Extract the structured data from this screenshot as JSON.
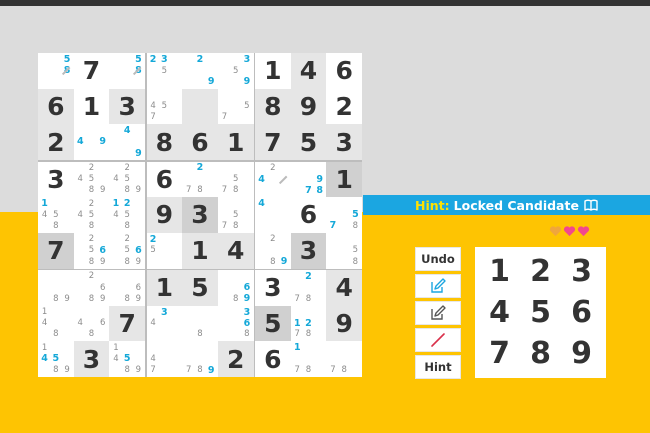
{
  "board": {
    "boxes": [
      {
        "cells": [
          {
            "cands": [
              {
                "n": 5,
                "pos": 2,
                "blue": true
              },
              {
                "n": 8,
                "pos": 5,
                "blue": true
              }
            ],
            "slash": true
          },
          {
            "value": "7"
          },
          {
            "cands": [
              {
                "n": 5,
                "pos": 2,
                "blue": true
              },
              {
                "n": 8,
                "pos": 5,
                "blue": true
              }
            ],
            "slash": true
          },
          {
            "value": "6",
            "hl": true
          },
          {
            "value": "1"
          },
          {
            "value": "3",
            "hl": true
          },
          {
            "value": "2",
            "hl": true
          },
          {
            "cands": [
              {
                "n": 4,
                "pos": 3,
                "blue": true
              },
              {
                "n": 9,
                "pos": 5,
                "blue": true
              }
            ]
          },
          {
            "cands": [
              {
                "n": 4,
                "pos": 1,
                "blue": true
              },
              {
                "n": 9,
                "pos": 8,
                "blue": true
              }
            ]
          }
        ]
      },
      {
        "cells": [
          {
            "cands": [
              {
                "n": 2,
                "pos": 0,
                "blue": true
              },
              {
                "n": 3,
                "pos": 1,
                "blue": true
              },
              {
                "n": 5,
                "pos": 4
              }
            ]
          },
          {
            "cands": [
              {
                "n": 2,
                "pos": 1,
                "blue": true
              },
              {
                "n": 9,
                "pos": 8,
                "blue": true
              }
            ]
          },
          {
            "cands": [
              {
                "n": 3,
                "pos": 2,
                "blue": true
              },
              {
                "n": 5,
                "pos": 4
              },
              {
                "n": 9,
                "pos": 8,
                "blue": true
              }
            ]
          },
          {
            "cands": [
              {
                "n": 4,
                "pos": 3
              },
              {
                "n": 5,
                "pos": 4
              },
              {
                "n": 7,
                "pos": 6
              }
            ]
          },
          {
            "hl": true
          },
          {
            "cands": [
              {
                "n": 5,
                "pos": 5
              },
              {
                "n": 7,
                "pos": 6
              }
            ]
          },
          {
            "value": "8",
            "hl": true
          },
          {
            "value": "6",
            "hl": true
          },
          {
            "value": "1",
            "hl": true
          }
        ]
      },
      {
        "cells": [
          {
            "value": "1"
          },
          {
            "value": "4",
            "hl": true
          },
          {
            "value": "6"
          },
          {
            "value": "8",
            "hl": true
          },
          {
            "value": "9",
            "hl": true
          },
          {
            "value": "2"
          },
          {
            "value": "7",
            "hl": true
          },
          {
            "value": "5",
            "hl": true
          },
          {
            "value": "3",
            "hl": true
          }
        ]
      },
      {
        "cells": [
          {
            "value": "3"
          },
          {
            "cands": [
              {
                "n": 2,
                "pos": 1
              },
              {
                "n": 4,
                "pos": 3
              },
              {
                "n": 5,
                "pos": 4
              },
              {
                "n": 8,
                "pos": 7
              },
              {
                "n": 9,
                "pos": 8
              }
            ]
          },
          {
            "cands": [
              {
                "n": 2,
                "pos": 1
              },
              {
                "n": 4,
                "pos": 3
              },
              {
                "n": 5,
                "pos": 4
              },
              {
                "n": 8,
                "pos": 7
              },
              {
                "n": 9,
                "pos": 8
              }
            ]
          },
          {
            "cands": [
              {
                "n": 1,
                "pos": 0,
                "blue": true
              },
              {
                "n": 4,
                "pos": 3
              },
              {
                "n": 5,
                "pos": 4
              },
              {
                "n": 8,
                "pos": 7
              }
            ]
          },
          {
            "cands": [
              {
                "n": 2,
                "pos": 1
              },
              {
                "n": 4,
                "pos": 3
              },
              {
                "n": 5,
                "pos": 4
              },
              {
                "n": 8,
                "pos": 7
              }
            ]
          },
          {
            "cands": [
              {
                "n": 1,
                "pos": 0,
                "blue": true
              },
              {
                "n": 2,
                "pos": 1,
                "blue": true
              },
              {
                "n": 4,
                "pos": 3
              },
              {
                "n": 5,
                "pos": 4
              },
              {
                "n": 8,
                "pos": 7
              }
            ]
          },
          {
            "value": "7",
            "dark": true
          },
          {
            "cands": [
              {
                "n": 2,
                "pos": 1
              },
              {
                "n": 5,
                "pos": 4
              },
              {
                "n": 6,
                "pos": 5,
                "blue": true
              },
              {
                "n": 8,
                "pos": 7
              },
              {
                "n": 9,
                "pos": 8
              }
            ]
          },
          {
            "cands": [
              {
                "n": 2,
                "pos": 1
              },
              {
                "n": 5,
                "pos": 4
              },
              {
                "n": 6,
                "pos": 5,
                "blue": true
              },
              {
                "n": 8,
                "pos": 7
              },
              {
                "n": 9,
                "pos": 8
              }
            ]
          }
        ]
      },
      {
        "cells": [
          {
            "value": "6"
          },
          {
            "cands": [
              {
                "n": 2,
                "pos": 1,
                "blue": true
              },
              {
                "n": 7,
                "pos": 6
              },
              {
                "n": 8,
                "pos": 7
              }
            ]
          },
          {
            "cands": [
              {
                "n": 5,
                "pos": 4
              },
              {
                "n": 7,
                "pos": 6
              },
              {
                "n": 8,
                "pos": 7
              }
            ]
          },
          {
            "value": "9",
            "hl": true
          },
          {
            "value": "3",
            "dark": true
          },
          {
            "cands": [
              {
                "n": 5,
                "pos": 4
              },
              {
                "n": 7,
                "pos": 6
              },
              {
                "n": 8,
                "pos": 7
              }
            ]
          },
          {
            "cands": [
              {
                "n": 2,
                "pos": 0,
                "blue": true
              },
              {
                "n": 5,
                "pos": 3
              }
            ]
          },
          {
            "value": "1",
            "hl": true
          },
          {
            "value": "4",
            "hl": true
          }
        ]
      },
      {
        "cells": [
          {
            "cands": [
              {
                "n": 2,
                "pos": 1
              },
              {
                "n": 4,
                "pos": 3,
                "blue": true
              }
            ],
            "slash": true
          },
          {
            "cands": [
              {
                "n": 9,
                "pos": 5,
                "blue": true
              },
              {
                "n": 7,
                "pos": 7,
                "blue": true
              },
              {
                "n": 8,
                "pos": 8,
                "blue": true
              }
            ]
          },
          {
            "value": "1",
            "dark": true
          },
          {
            "cands": [
              {
                "n": 4,
                "pos": 0,
                "blue": true
              }
            ]
          },
          {
            "value": "6"
          },
          {
            "cands": [
              {
                "n": 5,
                "pos": 5,
                "blue": true
              },
              {
                "n": 7,
                "pos": 6,
                "blue": true
              },
              {
                "n": 8,
                "pos": 8
              }
            ]
          },
          {
            "cands": [
              {
                "n": 2,
                "pos": 1
              },
              {
                "n": 8,
                "pos": 7
              },
              {
                "n": 9,
                "pos": 8,
                "blue": true
              }
            ]
          },
          {
            "value": "3",
            "dark": true
          },
          {
            "cands": [
              {
                "n": 5,
                "pos": 5
              },
              {
                "n": 8,
                "pos": 8
              }
            ]
          }
        ]
      },
      {
        "cells": [
          {
            "cands": [
              {
                "n": 8,
                "pos": 7
              },
              {
                "n": 9,
                "pos": 8
              }
            ]
          },
          {
            "cands": [
              {
                "n": 2,
                "pos": 1
              },
              {
                "n": 6,
                "pos": 5
              },
              {
                "n": 8,
                "pos": 7
              },
              {
                "n": 9,
                "pos": 8
              }
            ]
          },
          {
            "cands": [
              {
                "n": 6,
                "pos": 5
              },
              {
                "n": 8,
                "pos": 7
              },
              {
                "n": 9,
                "pos": 8
              }
            ]
          },
          {
            "cands": [
              {
                "n": 1,
                "pos": 0
              },
              {
                "n": 4,
                "pos": 3
              },
              {
                "n": 8,
                "pos": 7
              }
            ]
          },
          {
            "cands": [
              {
                "n": 4,
                "pos": 3
              },
              {
                "n": 6,
                "pos": 5
              },
              {
                "n": 8,
                "pos": 7
              }
            ]
          },
          {
            "value": "7",
            "hl": true
          },
          {
            "cands": [
              {
                "n": 1,
                "pos": 0
              },
              {
                "n": 4,
                "pos": 3,
                "blue": true
              },
              {
                "n": 5,
                "pos": 4,
                "blue": true
              },
              {
                "n": 8,
                "pos": 7
              },
              {
                "n": 9,
                "pos": 8
              }
            ]
          },
          {
            "value": "3",
            "hl": true
          },
          {
            "cands": [
              {
                "n": 1,
                "pos": 0
              },
              {
                "n": 4,
                "pos": 3
              },
              {
                "n": 5,
                "pos": 4,
                "blue": true
              },
              {
                "n": 8,
                "pos": 7
              },
              {
                "n": 9,
                "pos": 8
              }
            ]
          }
        ]
      },
      {
        "cells": [
          {
            "value": "1",
            "hl": true
          },
          {
            "value": "5",
            "hl": true
          },
          {
            "cands": [
              {
                "n": 6,
                "pos": 5,
                "blue": true
              },
              {
                "n": 8,
                "pos": 7
              },
              {
                "n": 9,
                "pos": 8,
                "blue": true
              }
            ]
          },
          {
            "cands": [
              {
                "n": 3,
                "pos": 1,
                "blue": true
              },
              {
                "n": 4,
                "pos": 3
              }
            ]
          },
          {
            "cands": [
              {
                "n": 8,
                "pos": 7
              }
            ]
          },
          {
            "cands": [
              {
                "n": 3,
                "pos": 2,
                "blue": true
              },
              {
                "n": 6,
                "pos": 5,
                "blue": true
              },
              {
                "n": 8,
                "pos": 8
              }
            ]
          },
          {
            "cands": [
              {
                "n": 4,
                "pos": 3
              },
              {
                "n": 7,
                "pos": 6
              }
            ]
          },
          {
            "cands": [
              {
                "n": 7,
                "pos": 6
              },
              {
                "n": 8,
                "pos": 7
              },
              {
                "n": 9,
                "pos": 8,
                "blue": true
              }
            ]
          },
          {
            "value": "2",
            "hl": true
          }
        ]
      },
      {
        "cells": [
          {
            "value": "3"
          },
          {
            "cands": [
              {
                "n": 2,
                "pos": 1,
                "blue": true
              },
              {
                "n": 7,
                "pos": 6
              },
              {
                "n": 8,
                "pos": 7
              }
            ]
          },
          {
            "value": "4",
            "hl": true
          },
          {
            "value": "5",
            "dark": true
          },
          {
            "cands": [
              {
                "n": 1,
                "pos": 3,
                "blue": true
              },
              {
                "n": 2,
                "pos": 4,
                "blue": true
              },
              {
                "n": 7,
                "pos": 6
              },
              {
                "n": 8,
                "pos": 7
              }
            ]
          },
          {
            "value": "9",
            "hl": true
          },
          {
            "value": "6"
          },
          {
            "cands": [
              {
                "n": 1,
                "pos": 0,
                "blue": true
              },
              {
                "n": 7,
                "pos": 6
              },
              {
                "n": 8,
                "pos": 7
              }
            ]
          },
          {
            "cands": [
              {
                "n": 7,
                "pos": 6
              },
              {
                "n": 8,
                "pos": 7
              }
            ]
          }
        ]
      }
    ]
  },
  "hint": {
    "label": "Hint:",
    "text": "Locked Candidate"
  },
  "hearts": [
    {
      "color": "#f0a63c"
    },
    {
      "color": "#f2478e"
    },
    {
      "color": "#f2478e"
    }
  ],
  "tools": {
    "undo_label": "Undo",
    "hint_label": "Hint"
  },
  "numpad": [
    "1",
    "2",
    "3",
    "4",
    "5",
    "6",
    "7",
    "8",
    "9"
  ],
  "colors": {
    "accent": "#1ba6e1",
    "background_lower": "#fec402",
    "candidate_blue": "#14a8d8",
    "hint_label_yellow": "#ffe100"
  }
}
